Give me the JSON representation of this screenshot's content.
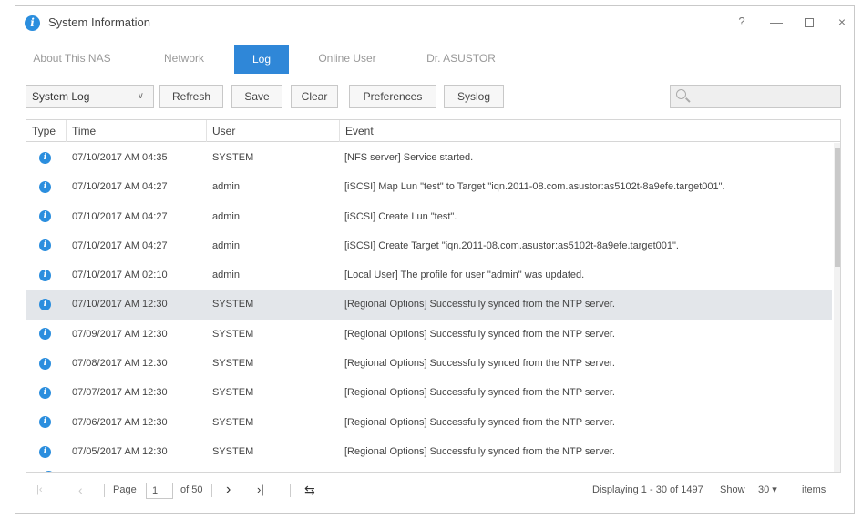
{
  "window": {
    "title": "System Information",
    "controls": {
      "help": "?",
      "minimize": "—",
      "close": "×"
    }
  },
  "tabs": [
    {
      "label": "About This NAS",
      "active": false
    },
    {
      "label": "Network",
      "active": false
    },
    {
      "label": "Log",
      "active": true
    },
    {
      "label": "Online User",
      "active": false
    },
    {
      "label": "Dr. ASUSTOR",
      "active": false
    }
  ],
  "toolbar": {
    "log_select": "System Log",
    "refresh": "Refresh",
    "save": "Save",
    "clear": "Clear",
    "preferences": "Preferences",
    "syslog": "Syslog",
    "search_placeholder": ""
  },
  "grid": {
    "headers": {
      "type": "Type",
      "time": "Time",
      "user": "User",
      "event": "Event"
    },
    "rows": [
      {
        "time": "07/10/2017 AM 04:35",
        "user": "SYSTEM",
        "event": "[NFS server] Service started."
      },
      {
        "time": "07/10/2017 AM 04:27",
        "user": "admin",
        "event": "[iSCSI] Map Lun \"test\" to Target \"iqn.2011-08.com.asustor:as5102t-8a9efe.target001\"."
      },
      {
        "time": "07/10/2017 AM 04:27",
        "user": "admin",
        "event": "[iSCSI] Create Lun \"test\"."
      },
      {
        "time": "07/10/2017 AM 04:27",
        "user": "admin",
        "event": "[iSCSI] Create Target \"iqn.2011-08.com.asustor:as5102t-8a9efe.target001\"."
      },
      {
        "time": "07/10/2017 AM 02:10",
        "user": "admin",
        "event": "[Local User] The profile for user \"admin\" was updated."
      },
      {
        "time": "07/10/2017 AM 12:30",
        "user": "SYSTEM",
        "event": "[Regional Options] Successfully synced from the NTP server.",
        "selected": true
      },
      {
        "time": "07/09/2017 AM 12:30",
        "user": "SYSTEM",
        "event": "[Regional Options] Successfully synced from the NTP server."
      },
      {
        "time": "07/08/2017 AM 12:30",
        "user": "SYSTEM",
        "event": "[Regional Options] Successfully synced from the NTP server."
      },
      {
        "time": "07/07/2017 AM 12:30",
        "user": "SYSTEM",
        "event": "[Regional Options] Successfully synced from the NTP server."
      },
      {
        "time": "07/06/2017 AM 12:30",
        "user": "SYSTEM",
        "event": "[Regional Options] Successfully synced from the NTP server."
      },
      {
        "time": "07/05/2017 AM 12:30",
        "user": "SYSTEM",
        "event": "[Regional Options] Successfully synced from the NTP server."
      }
    ]
  },
  "pager": {
    "first": "|‹",
    "prev": "‹",
    "page_label": "Page",
    "page_value": "1",
    "of_label": "of 50",
    "next": "›",
    "last": "›|",
    "refresh": "⇆",
    "displaying": "Displaying 1 - 30 of 1497",
    "show_label": "Show",
    "page_size": "30 ▾",
    "items_label": "items"
  },
  "colors": {
    "accent": "#2f87d8",
    "info_icon": "#2b8ede",
    "selected_row": "#e3e6ea"
  }
}
